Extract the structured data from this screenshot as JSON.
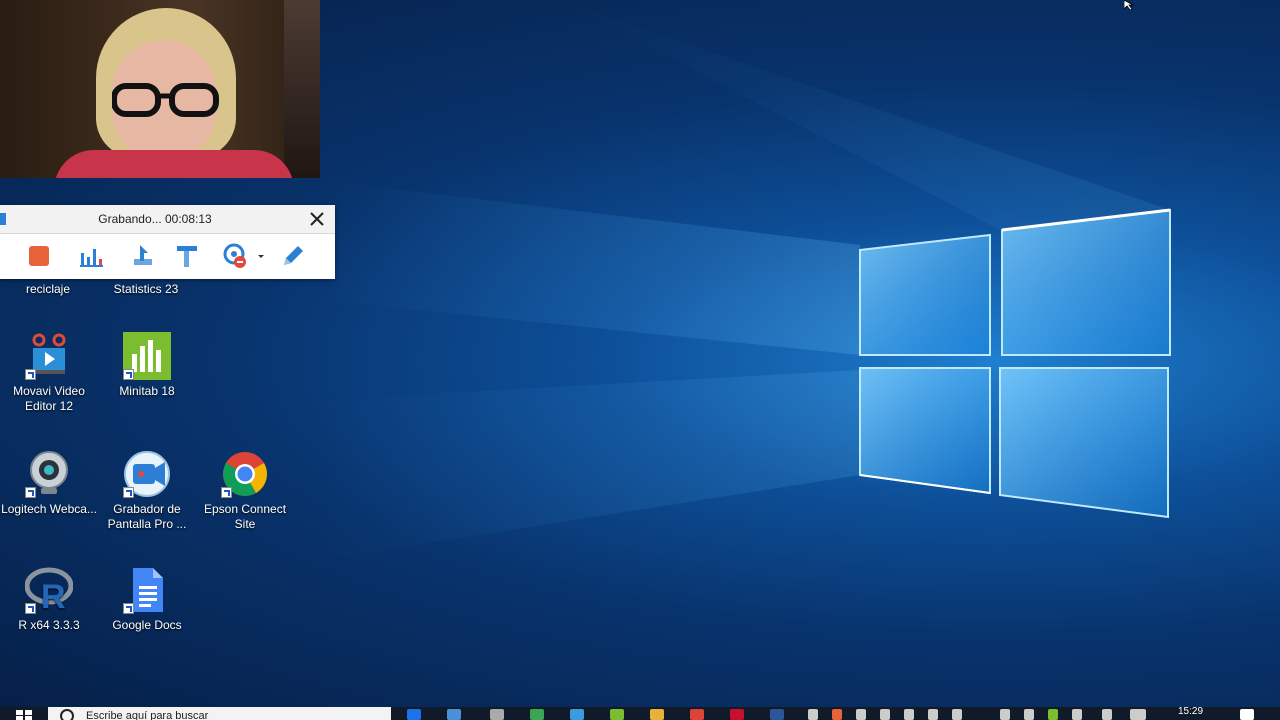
{
  "recorder": {
    "status": "Grabando... 00:08:13",
    "close_icon": "close-icon",
    "tools": [
      "stop-icon",
      "bar-chart-icon",
      "cursor-effects-icon",
      "annotation-icon",
      "webcam-icon",
      "pen-icon"
    ]
  },
  "desktop": {
    "partial_labels": [
      "reciclaje",
      "Statistics 23"
    ],
    "icons": [
      {
        "label": "Movavi Video Editor 12",
        "icon": "movavi-icon"
      },
      {
        "label": "Minitab 18",
        "icon": "minitab-icon"
      },
      {
        "label": "Logitech Webca...",
        "icon": "webcam-app-icon"
      },
      {
        "label": "Grabador de Pantalla Pro ...",
        "icon": "screen-recorder-icon"
      },
      {
        "label": "Epson Connect Site",
        "icon": "chrome-icon"
      },
      {
        "label": "R x64 3.3.3",
        "icon": "r-language-icon"
      },
      {
        "label": "Google Docs",
        "icon": "google-docs-icon"
      }
    ]
  },
  "taskbar": {
    "search_placeholder": "Escribe aquí para buscar",
    "clock": "15:29"
  },
  "colors": {
    "accent": "#1c57c9",
    "stop": "#e8623a",
    "minitab": "#7bbd2e",
    "taskbar": "#101a28"
  }
}
